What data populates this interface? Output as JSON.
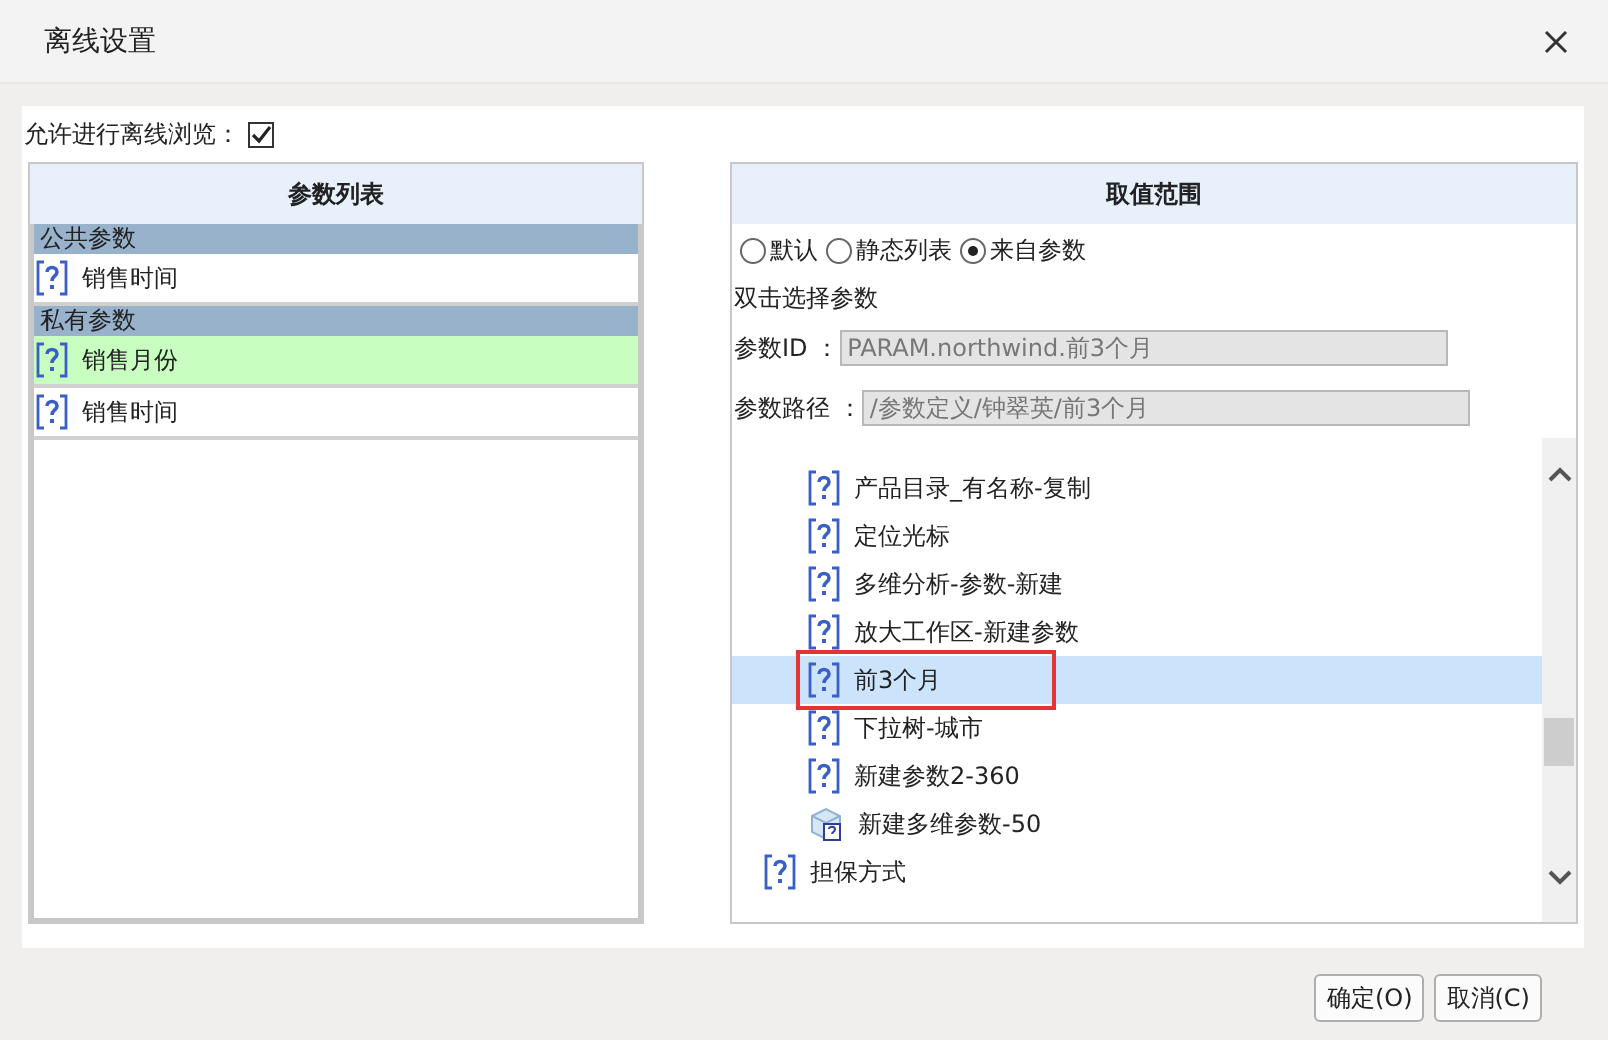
{
  "window": {
    "title": "离线设置"
  },
  "offline_browse": {
    "label": "允许进行离线浏览：",
    "checked": true
  },
  "param_list": {
    "title": "参数列表",
    "groups": [
      {
        "title": "公共参数",
        "items": [
          {
            "label": "销售时间",
            "selected": false
          }
        ]
      },
      {
        "title": "私有参数",
        "items": [
          {
            "label": "销售月份",
            "selected": true
          },
          {
            "label": "销售时间",
            "selected": false
          }
        ]
      }
    ]
  },
  "value_range": {
    "title": "取值范围",
    "options": [
      {
        "label": "默认",
        "selected": false
      },
      {
        "label": "静态列表",
        "selected": false
      },
      {
        "label": "来自参数",
        "selected": true
      }
    ],
    "hint": "双击选择参数",
    "fields": [
      {
        "label": "参数ID ：",
        "value": "PARAM.northwind.前3个月"
      },
      {
        "label": "参数路径 ：",
        "value": "/参数定义/钟翠英/前3个月"
      }
    ],
    "tree": [
      {
        "children": [
          {
            "kind": "param",
            "label": "产品目录_有名称-复制",
            "selected": false
          },
          {
            "kind": "param",
            "label": "定位光标",
            "selected": false
          },
          {
            "kind": "param",
            "label": "多维分析-参数-新建",
            "selected": false
          },
          {
            "kind": "param",
            "label": "放大工作区-新建参数",
            "selected": false
          },
          {
            "kind": "param",
            "label": "前3个月",
            "selected": true
          },
          {
            "kind": "param",
            "label": "下拉树-城市",
            "selected": false
          },
          {
            "kind": "param",
            "label": "新建参数2-360",
            "selected": false
          },
          {
            "kind": "cube",
            "label": "新建多维参数-50",
            "selected": false
          }
        ]
      },
      {
        "kind": "param",
        "label": "担保方式",
        "selected": false
      }
    ]
  },
  "buttons": [
    "确定(O)",
    "取消(C)"
  ]
}
